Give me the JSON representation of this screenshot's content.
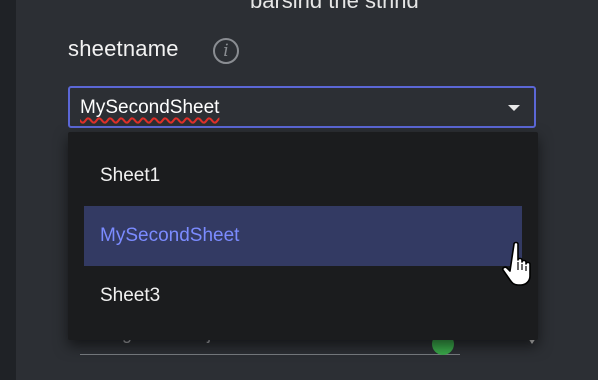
{
  "header": {
    "cut_text": "parsing the string"
  },
  "field": {
    "label": "sheetname",
    "info_icon": "info-icon",
    "selected_value": "MySecondSheet"
  },
  "dropdown": {
    "options": [
      {
        "label": "Sheet1",
        "highlighted": false
      },
      {
        "label": "MySecondSheet",
        "highlighted": true
      },
      {
        "label": "Sheet3",
        "highlighted": false
      }
    ]
  },
  "background_field": {
    "value": "GoogleSheets.js",
    "status_icon": "green-status-dot"
  },
  "colors": {
    "panel_bg": "#2c2f34",
    "dropdown_bg": "#1b1c1e",
    "focus_border": "#5b67d6",
    "highlight_bg": "#333a63",
    "highlight_text": "#7b8bff",
    "status_green": "#3aa84a"
  },
  "cursor": "hand-pointer-icon"
}
